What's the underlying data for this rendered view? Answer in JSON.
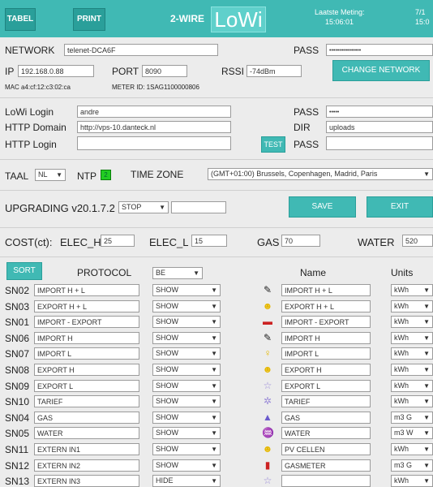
{
  "header": {
    "tabel_label": "TABEL",
    "print_label": "PRINT",
    "wire_label": "2-WIRE",
    "brand": "LoWi",
    "last_measure_label": "Laatste Meting:",
    "last_measure_time": "15:06:01",
    "date_partial": "7/1",
    "time_partial": "15:0"
  },
  "network": {
    "label": "NETWORK",
    "ssid": "telenet-DCA6F",
    "pass_label": "PASS",
    "pass_value": "••••••••••••••••",
    "ip_label": "IP",
    "ip_value": "192.168.0.88",
    "port_label": "PORT",
    "port_value": "8090",
    "rssi_label": "RSSI",
    "rssi_value": "-74dBm",
    "change_label": "CHANGE NETWORK",
    "mac_text": "MAC a4:cf:12:c3:02:ca",
    "meter_text": "METER ID: 1SAG1100000806"
  },
  "lowi": {
    "login_label": "LoWi Login",
    "login_value": "andre",
    "pass_label": "PASS",
    "pass_value": "•••••",
    "domain_label": "HTTP Domain",
    "domain_value": "http://vps-10.danteck.nl",
    "dir_label": "DIR",
    "dir_value": "uploads",
    "http_login_label": "HTTP Login",
    "http_login_value": "",
    "test_label": "TEST",
    "http_pass_label": "PASS",
    "http_pass_value": ""
  },
  "locale": {
    "taal_label": "TAAL",
    "taal_value": "NL",
    "ntp_label": "NTP",
    "ntp_value": "2",
    "tz_label": "TIME ZONE",
    "tz_value": "(GMT+01:00) Brussels, Copenhagen, Madrid, Paris"
  },
  "upgrade": {
    "label": "UPGRADING v20.1.7.2",
    "select_value": "STOP",
    "input_value": "",
    "save_label": "SAVE",
    "exit_label": "EXIT"
  },
  "cost": {
    "label": "COST(ct):",
    "elec_h_label": "ELEC_H",
    "elec_h_value": "25",
    "elec_l_label": "ELEC_L",
    "elec_l_value": "15",
    "gas_label": "GAS",
    "gas_value": "70",
    "water_label": "WATER",
    "water_value": "520"
  },
  "table": {
    "sort_label": "SORT",
    "protocol_label": "PROTOCOL",
    "protocol_value": "BE",
    "name_label": "Name",
    "units_label": "Units",
    "rows": [
      {
        "sn": "SN02",
        "field": "IMPORT H + L",
        "show": "SHOW",
        "icon": "plug-icon",
        "glyph": "✎",
        "color": "#222222",
        "name": "IMPORT H + L",
        "unit": "kWh"
      },
      {
        "sn": "SN03",
        "field": "EXPORT H + L",
        "show": "SHOW",
        "icon": "sun-icon",
        "glyph": "☻",
        "color": "#e6b800",
        "name": "EXPORT H + L",
        "unit": "kWh"
      },
      {
        "sn": "SN01",
        "field": "IMPORT - EXPORT",
        "show": "SHOW",
        "icon": "car-icon",
        "glyph": "▬",
        "color": "#cc2222",
        "name": "IMPORT - EXPORT",
        "unit": "kWh"
      },
      {
        "sn": "SN06",
        "field": "IMPORT H",
        "show": "SHOW",
        "icon": "plug-icon",
        "glyph": "✎",
        "color": "#222222",
        "name": "IMPORT H",
        "unit": "kWh"
      },
      {
        "sn": "SN07",
        "field": "IMPORT L",
        "show": "SHOW",
        "icon": "bulb-icon",
        "glyph": "♀",
        "color": "#e6b800",
        "name": "IMPORT L",
        "unit": "kWh"
      },
      {
        "sn": "SN08",
        "field": "EXPORT H",
        "show": "SHOW",
        "icon": "sun-icon",
        "glyph": "☻",
        "color": "#e6b800",
        "name": "EXPORT H",
        "unit": "kWh"
      },
      {
        "sn": "SN09",
        "field": "EXPORT L",
        "show": "SHOW",
        "icon": "star-icon",
        "glyph": "☆",
        "color": "#9a8ad8",
        "name": "EXPORT L",
        "unit": "kWh"
      },
      {
        "sn": "SN10",
        "field": "TARIEF",
        "show": "SHOW",
        "icon": "gear-icon",
        "glyph": "✲",
        "color": "#9a8ad8",
        "name": "TARIEF",
        "unit": "kWh"
      },
      {
        "sn": "SN04",
        "field": "GAS",
        "show": "SHOW",
        "icon": "flame-icon",
        "glyph": "▲",
        "color": "#6a5acd",
        "name": "GAS",
        "unit": "m3 G"
      },
      {
        "sn": "SN05",
        "field": "WATER",
        "show": "SHOW",
        "icon": "faucet-icon",
        "glyph": "♒",
        "color": "#2a7fd0",
        "name": "WATER",
        "unit": "m3 W"
      },
      {
        "sn": "SN11",
        "field": "EXTERN IN1",
        "show": "SHOW",
        "icon": "sun-icon",
        "glyph": "☻",
        "color": "#e6b800",
        "name": "PV CELLEN",
        "unit": "kWh"
      },
      {
        "sn": "SN12",
        "field": "EXTERN IN2",
        "show": "SHOW",
        "icon": "gas-can-icon",
        "glyph": "▮",
        "color": "#cc2222",
        "name": "GASMETER",
        "unit": "m3 G"
      },
      {
        "sn": "SN13",
        "field": "EXTERN IN3",
        "show": "HIDE",
        "icon": "star-icon",
        "glyph": "☆",
        "color": "#9a8ad8",
        "name": "",
        "unit": "kWh"
      }
    ]
  }
}
